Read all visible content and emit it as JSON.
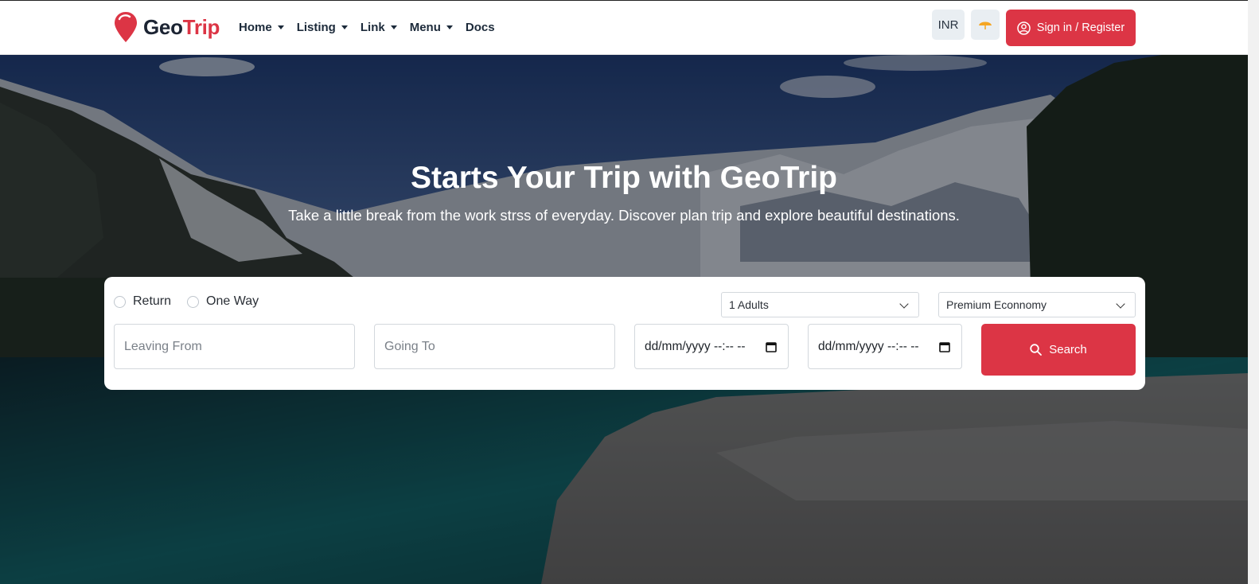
{
  "brand": {
    "name_part1": "Geo",
    "name_part2": "Trip"
  },
  "nav": {
    "items": [
      {
        "label": "Home",
        "has_dropdown": true
      },
      {
        "label": "Listing",
        "has_dropdown": true
      },
      {
        "label": "Link",
        "has_dropdown": true
      },
      {
        "label": "Menu",
        "has_dropdown": true
      },
      {
        "label": "Docs",
        "has_dropdown": false
      }
    ],
    "currency": "INR",
    "theme_icon": "umbrella-icon",
    "signin_label": "Sign in / Register"
  },
  "hero": {
    "title": "Starts Your Trip with GeoTrip",
    "subtitle": "Take a little break from the work strss of everyday. Discover plan trip and explore beautiful destinations."
  },
  "search": {
    "trip_types": [
      "Return",
      "One Way"
    ],
    "adults_selected": "1 Adults",
    "class_selected": "Premium Econnomy",
    "leaving_placeholder": "Leaving From",
    "going_placeholder": "Going To",
    "depart_date": "dd/mm/yyyy --:-- --",
    "return_date": "dd/mm/yyyy --:-- --",
    "search_label": "Search"
  },
  "colors": {
    "accent": "#dc3545",
    "brand_dark": "#1c2433",
    "theme_icon": "#f5a623"
  }
}
